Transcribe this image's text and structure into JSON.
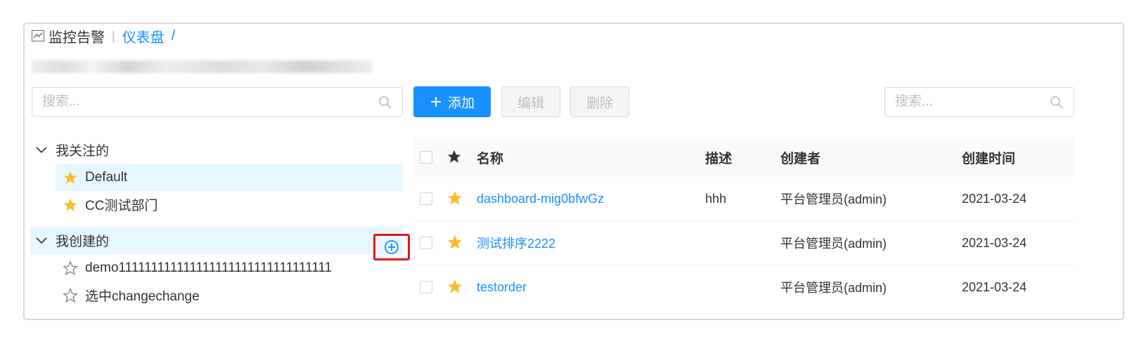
{
  "breadcrumb": {
    "root": "监控告警",
    "separator": "|",
    "current": "仪表盘",
    "slash": "/"
  },
  "left": {
    "search_placeholder": "搜索...",
    "groups": [
      {
        "label": "我关注的",
        "items": [
          {
            "label": "Default",
            "starred": true,
            "selected": true
          },
          {
            "label": "CC测试部门",
            "starred": true
          }
        ]
      },
      {
        "label": "我创建的",
        "items": [
          {
            "label": "demo111111111111111111111111111111111",
            "starred": false
          },
          {
            "label": "选中changechange",
            "starred": false
          }
        ]
      }
    ]
  },
  "toolbar": {
    "add_label": "添加",
    "edit_label": "编辑",
    "delete_label": "删除",
    "search_placeholder": "搜索..."
  },
  "table": {
    "columns": [
      "名称",
      "描述",
      "创建者",
      "创建时间"
    ],
    "rows": [
      {
        "name": "dashboard-mig0bfwGz",
        "desc": "hhh",
        "creator": "平台管理员(admin)",
        "created": "2021-03-24"
      },
      {
        "name": "测试排序2222",
        "desc": "",
        "creator": "平台管理员(admin)",
        "created": "2021-03-24"
      },
      {
        "name": "testorder",
        "desc": "",
        "creator": "平台管理员(admin)",
        "created": "2021-03-24"
      }
    ]
  },
  "colors": {
    "primary": "#1890ff",
    "star": "#fbbd2c",
    "highlight": "#e5171c",
    "selected_bg": "#e6f7ff"
  }
}
